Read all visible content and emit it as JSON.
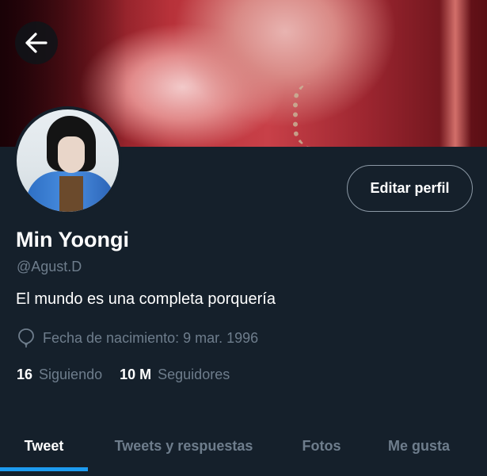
{
  "profile": {
    "name": "Min Yoongi",
    "handle": "@Agust.D",
    "bio": "El mundo es una completa porquería",
    "birth_date": "Fecha de nacimiento: 9 mar. 1996",
    "edit_label": "Editar perfil"
  },
  "stats": {
    "following_count": "16",
    "following_label": "Siguiendo",
    "followers_count": "10 M",
    "followers_label": "Seguidores"
  },
  "tabs": [
    {
      "label": "Tweet",
      "active": true
    },
    {
      "label": "Tweets y respuestas",
      "active": false
    },
    {
      "label": "Fotos",
      "active": false
    },
    {
      "label": "Me gusta",
      "active": false
    }
  ],
  "colors": {
    "background": "#15202b",
    "accent": "#1d9bf0",
    "secondary_text": "#6e7d8c"
  },
  "icons": {
    "back": "arrow-left-icon",
    "birth": "balloon-icon"
  }
}
